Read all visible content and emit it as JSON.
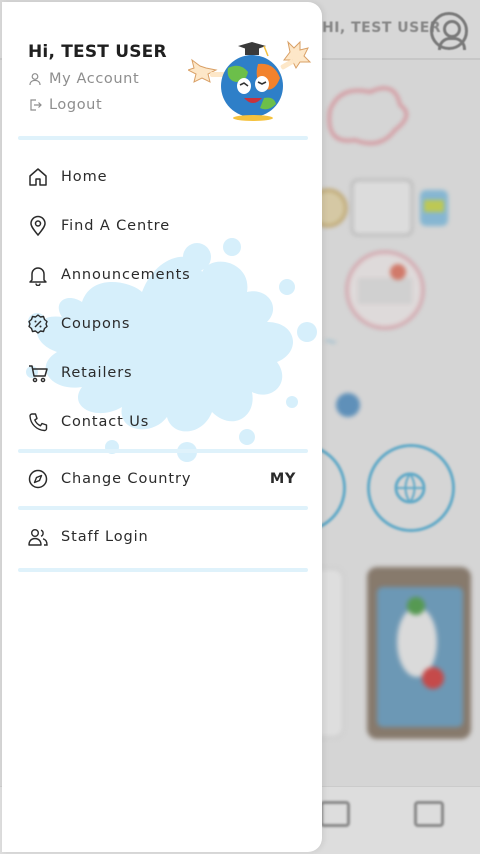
{
  "background": {
    "greeting": "HI, TEST USER"
  },
  "drawer": {
    "greeting": "Hi, TEST USER",
    "my_account": "My Account",
    "logout": "Logout",
    "menu": [
      {
        "label": "Home",
        "icon": "home-icon"
      },
      {
        "label": "Find A Centre",
        "icon": "location-pin-icon"
      },
      {
        "label": "Announcements",
        "icon": "bell-icon"
      },
      {
        "label": "Coupons",
        "icon": "coupon-icon"
      },
      {
        "label": "Retailers",
        "icon": "cart-icon"
      },
      {
        "label": "Contact Us",
        "icon": "phone-icon"
      }
    ],
    "change_country": {
      "label": "Change Country",
      "value": "MY",
      "icon": "compass-icon"
    },
    "staff_login": {
      "label": "Staff Login",
      "icon": "users-icon"
    }
  },
  "colors": {
    "divider": "#dff2fb",
    "splash": "#d6effb",
    "accent_blue": "#5ab3d8",
    "text_primary": "#2b2b2b",
    "text_muted": "#8e8e8e"
  }
}
